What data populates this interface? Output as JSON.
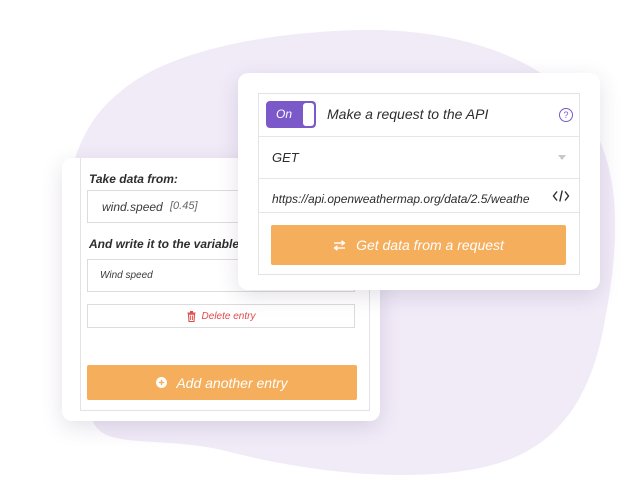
{
  "colors": {
    "accent": "#f5ae5b",
    "toggle": "#7b59c9",
    "blob": "#f1ebf8",
    "delete": "#e04a4a"
  },
  "left_panel": {
    "take_label": "Take data from:",
    "source_value": "wind.speed",
    "source_hint": "[0.45]",
    "write_label": "And write it to the variable",
    "variable_value": "Wind speed",
    "delete_label": "Delete entry",
    "delete_icon": "trash-icon",
    "add_label": "Add another entry",
    "add_icon": "plus-circle-icon"
  },
  "right_panel": {
    "toggle_label": "On",
    "toggle_state": "on",
    "title": "Make a request to the API",
    "help_icon": "question-icon",
    "method": "GET",
    "url": "https://api.openweathermap.org/data/2.5/weathe",
    "code_icon": "code-icon",
    "get_label": "Get data from a request",
    "get_icon": "swap-arrows-icon"
  }
}
